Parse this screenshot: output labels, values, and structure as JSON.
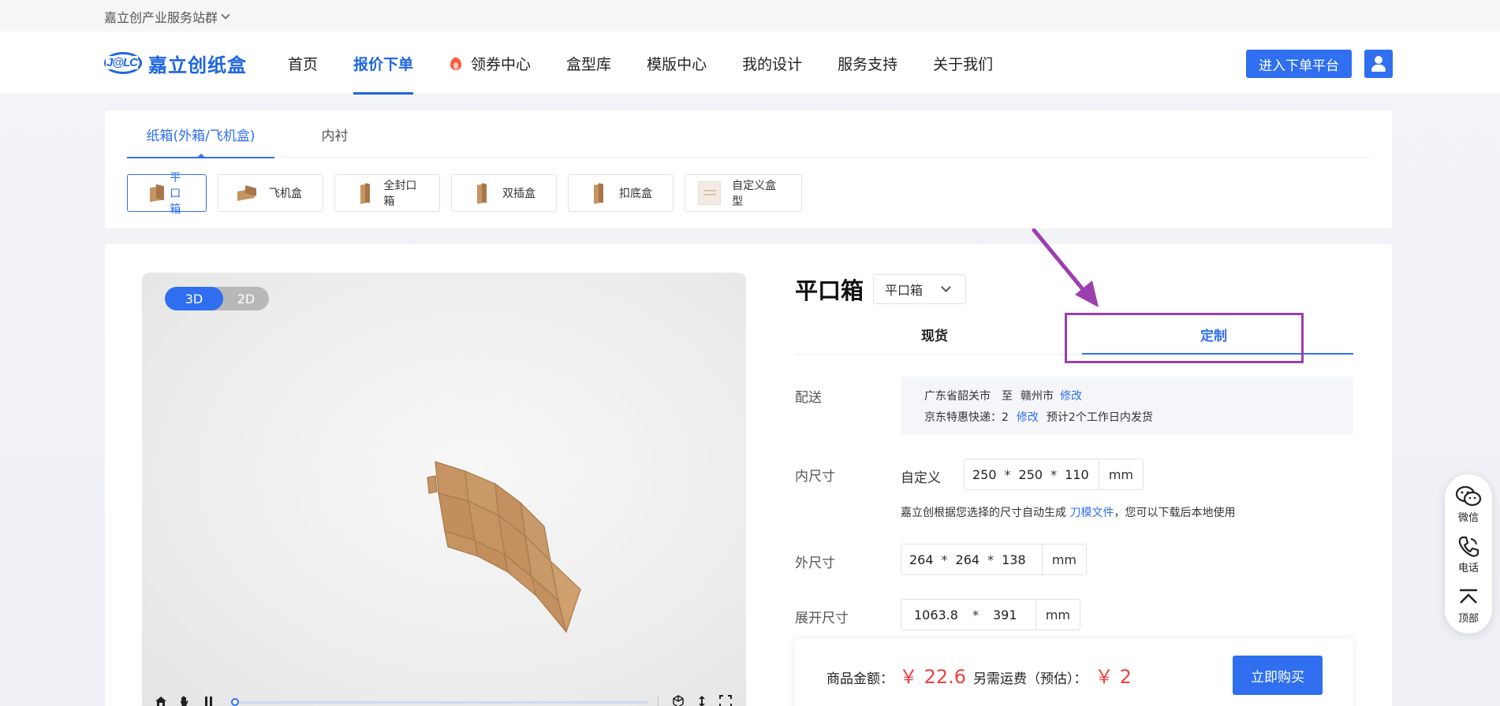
{
  "topbar": {
    "group_label": "嘉立创产业服务站群"
  },
  "header": {
    "logo_mark": "J@LC",
    "logo_name": "嘉立创纸盒",
    "nav": [
      {
        "label": "首页"
      },
      {
        "label": "报价下单"
      },
      {
        "label": "领券中心"
      },
      {
        "label": "盒型库"
      },
      {
        "label": "模版中心"
      },
      {
        "label": "我的设计"
      },
      {
        "label": "服务支持"
      },
      {
        "label": "关于我们"
      }
    ],
    "platform_button": "进入下单平台"
  },
  "category": {
    "tabs": [
      {
        "label": "纸箱(外箱/飞机盒)"
      },
      {
        "label": "内衬"
      }
    ],
    "box_types": [
      {
        "label": "平口箱"
      },
      {
        "label": "飞机盒"
      },
      {
        "label": "全封口箱"
      },
      {
        "label": "双插盒"
      },
      {
        "label": "扣底盒"
      },
      {
        "label": "自定义盒型"
      }
    ]
  },
  "viewer": {
    "toggle_3d": "3D",
    "toggle_2d": "2D",
    "progress": 0.01
  },
  "product": {
    "title": "平口箱",
    "select_value": "平口箱",
    "mode_tabs": [
      {
        "label": "现货"
      },
      {
        "label": "定制"
      }
    ]
  },
  "shipping": {
    "label": "配送",
    "from": "广东省韶关市",
    "to_word": "至",
    "to": "赣州市",
    "edit1": "修改",
    "express": "京东特惠快递：2",
    "edit2": "修改",
    "eta": "预计2个工作日内发货"
  },
  "inner_size": {
    "label": "内尺寸",
    "mode": "自定义",
    "length": "250",
    "width": "250",
    "height": "110",
    "sep": "*",
    "unit": "mm",
    "note_prefix": "嘉立创根据您选择的尺寸自动生成",
    "note_link": "刀模文件",
    "note_suffix": "，您可以下载后本地使用"
  },
  "outer_size": {
    "label": "外尺寸",
    "length": "264",
    "width": "264",
    "height": "138",
    "sep": "*",
    "unit": "mm"
  },
  "unfold_size": {
    "label": "展开尺寸",
    "length": "1063.8",
    "width": "391",
    "sep": "*",
    "unit": "mm"
  },
  "price": {
    "goods_label": "商品金额：",
    "goods_amount": "￥ 22.6",
    "freight_label": "另需运费（预估）：",
    "freight_amount": "￥ 2",
    "buy_button": "立即购买"
  },
  "side_float": [
    {
      "label": "微信",
      "icon": "wechat-icon"
    },
    {
      "label": "电话",
      "icon": "phone-icon"
    },
    {
      "label": "顶部",
      "icon": "back-to-top-icon"
    }
  ],
  "colors": {
    "primary": "#2f6ff0",
    "price": "#f04040",
    "highlight": "#9b3fae",
    "cardboard": "#c69462"
  }
}
